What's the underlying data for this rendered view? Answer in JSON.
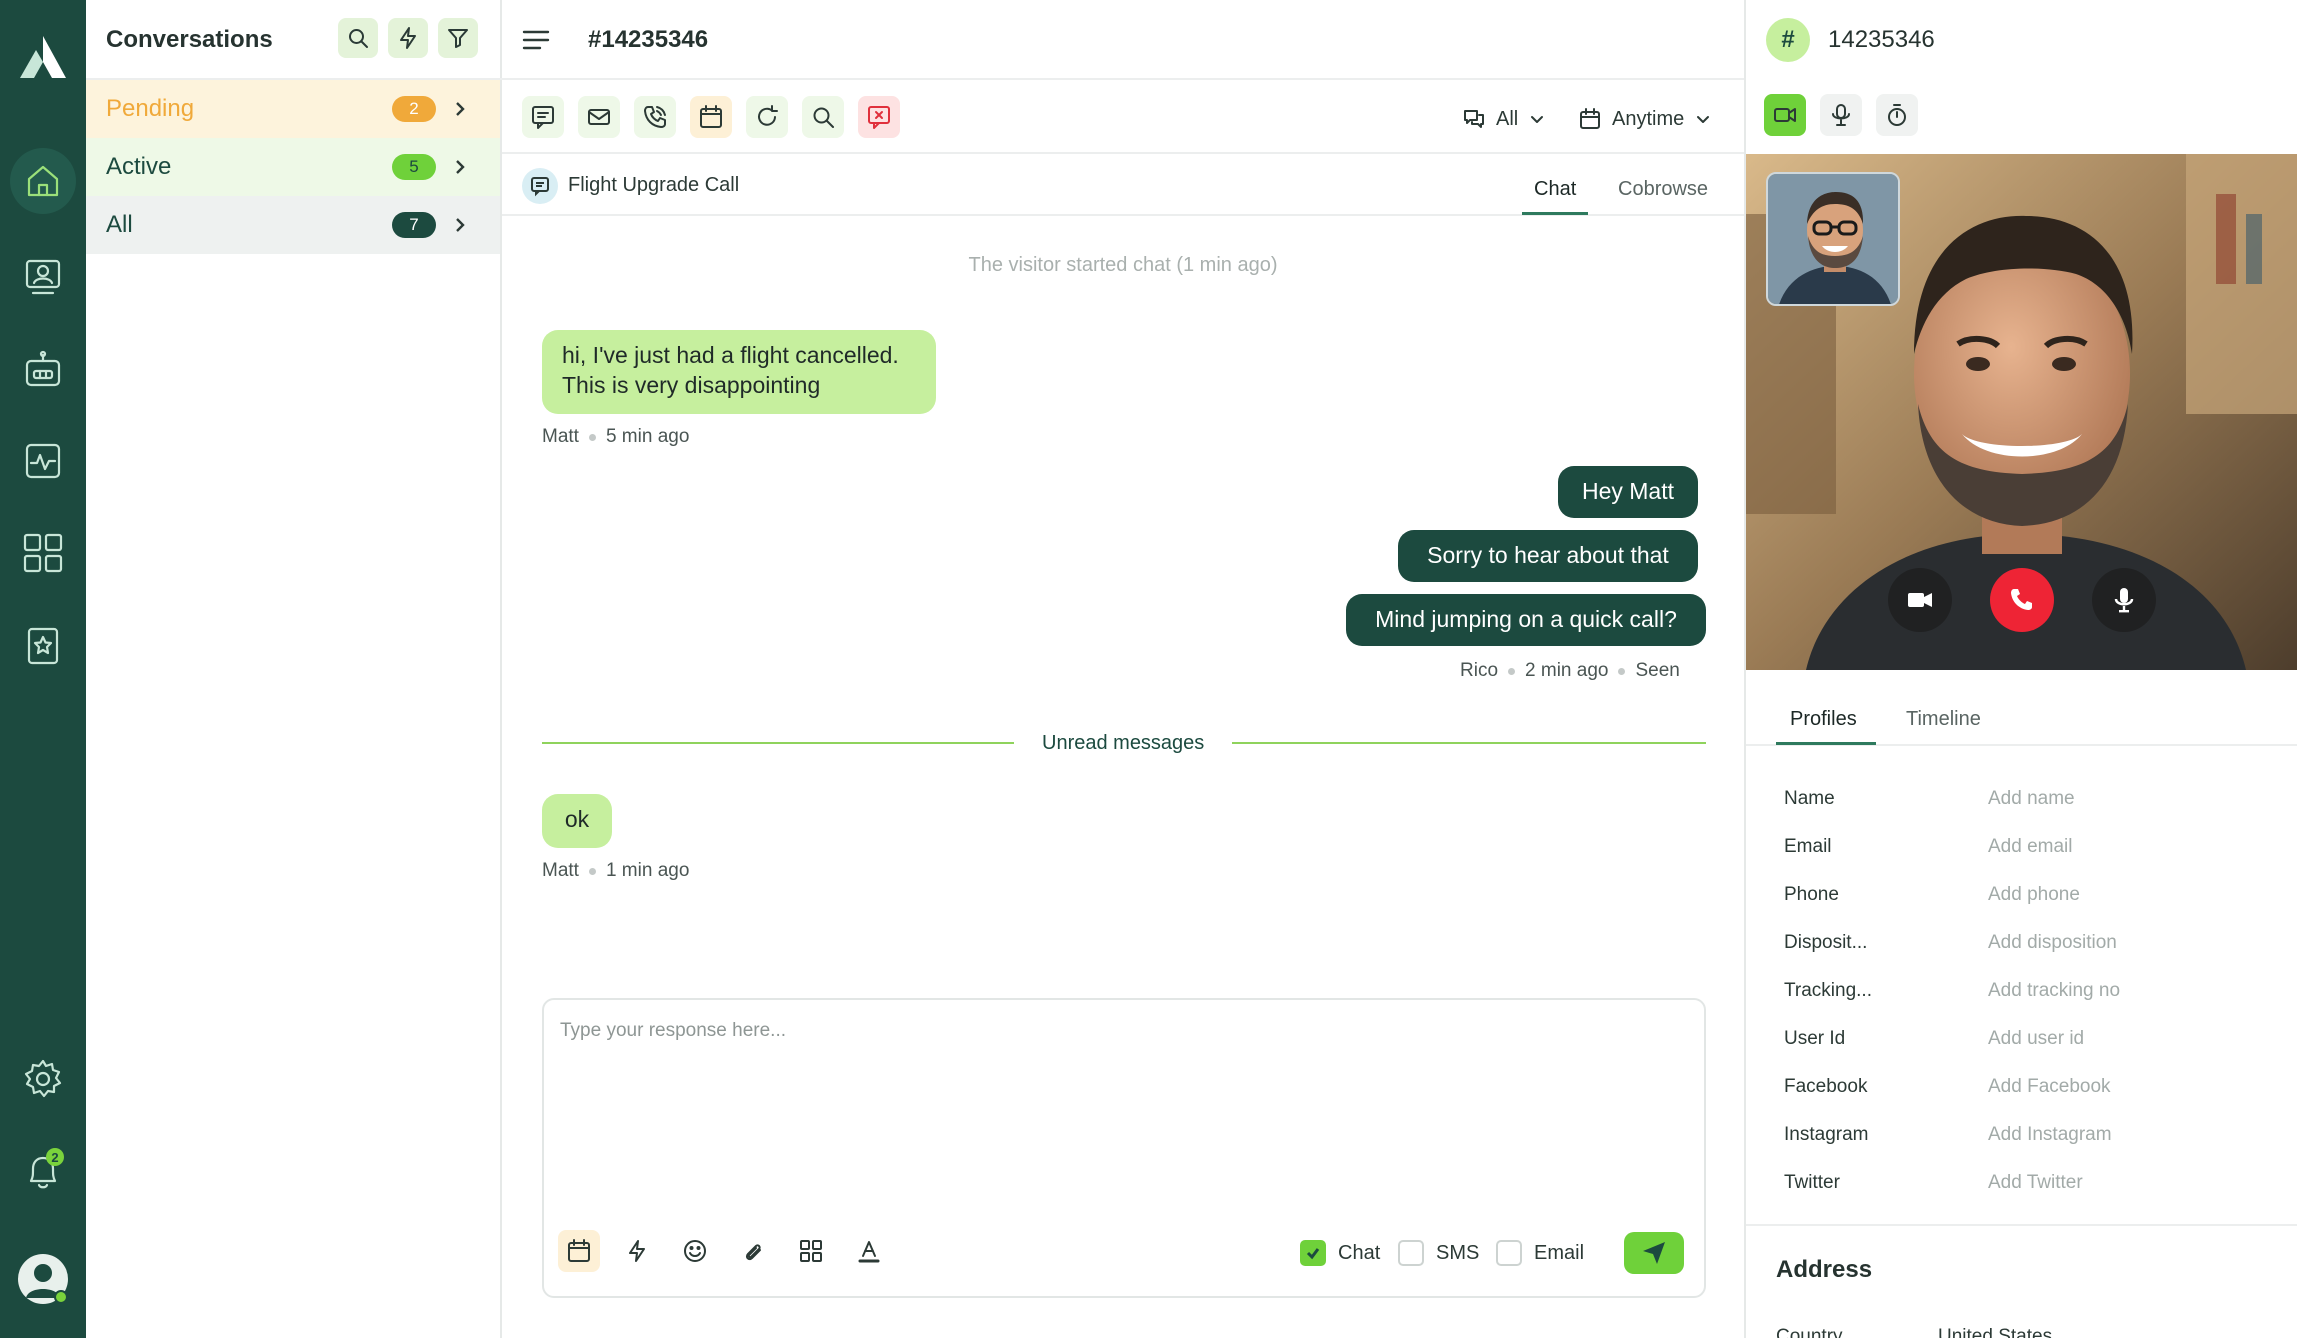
{
  "colors": {
    "rail": "#1c4a3f",
    "accent": "#6fd13a",
    "bubble_in": "#c6ef9e",
    "bubble_out": "#1c4a3f",
    "pending": "#f0a93a"
  },
  "rail": {
    "items": [
      "home-icon",
      "agent-monitor-icon",
      "bot-icon",
      "activity-icon",
      "apps-grid-icon",
      "star-card-icon"
    ],
    "bottom": [
      "settings-icon",
      "bell-icon",
      "avatar"
    ],
    "bell_badge": "2"
  },
  "conversations": {
    "title": "Conversations",
    "rows": [
      {
        "label": "Pending",
        "count": "2"
      },
      {
        "label": "Active",
        "count": "5"
      },
      {
        "label": "All",
        "count": "7"
      }
    ]
  },
  "chat": {
    "ticket": "#14235346",
    "filters": {
      "channel": "All",
      "time": "Anytime"
    },
    "subject": "Flight Upgrade Call",
    "tabs": [
      "Chat",
      "Cobrowse"
    ],
    "system_message": "The visitor started chat (1 min ago)",
    "messages": [
      {
        "line1": "hi, I've just had a flight cancelled.",
        "line2": "This is very disappointing",
        "author": "Matt",
        "time": "5 min ago"
      },
      {
        "text": "Hey Matt"
      },
      {
        "text": "Sorry to hear about that"
      },
      {
        "text": "Mind jumping on a quick call?",
        "author": "Rico",
        "time": "2 min ago",
        "status": "Seen"
      },
      {
        "text": "ok",
        "author": "Matt",
        "time": "1 min ago"
      }
    ],
    "unread_label": "Unread messages",
    "composer": {
      "placeholder": "Type your response here...",
      "channels": [
        {
          "label": "Chat",
          "checked": true
        },
        {
          "label": "SMS",
          "checked": false
        },
        {
          "label": "Email",
          "checked": false
        }
      ]
    }
  },
  "contact": {
    "id": "14235346",
    "hash": "#",
    "tabs": [
      "Profiles",
      "Timeline"
    ],
    "fields": [
      {
        "key": "Name",
        "value": "Add name"
      },
      {
        "key": "Email",
        "value": "Add email"
      },
      {
        "key": "Phone",
        "value": "Add phone"
      },
      {
        "key": "Disposit...",
        "value": "Add disposition"
      },
      {
        "key": "Tracking...",
        "value": "Add tracking no"
      },
      {
        "key": "User Id",
        "value": "Add user id"
      },
      {
        "key": "Facebook",
        "value": "Add Facebook"
      },
      {
        "key": "Instagram",
        "value": "Add Instagram"
      },
      {
        "key": "Twitter",
        "value": "Add Twitter"
      }
    ],
    "address_title": "Address",
    "address_country_key": "Country",
    "address_country_value": "United States"
  }
}
